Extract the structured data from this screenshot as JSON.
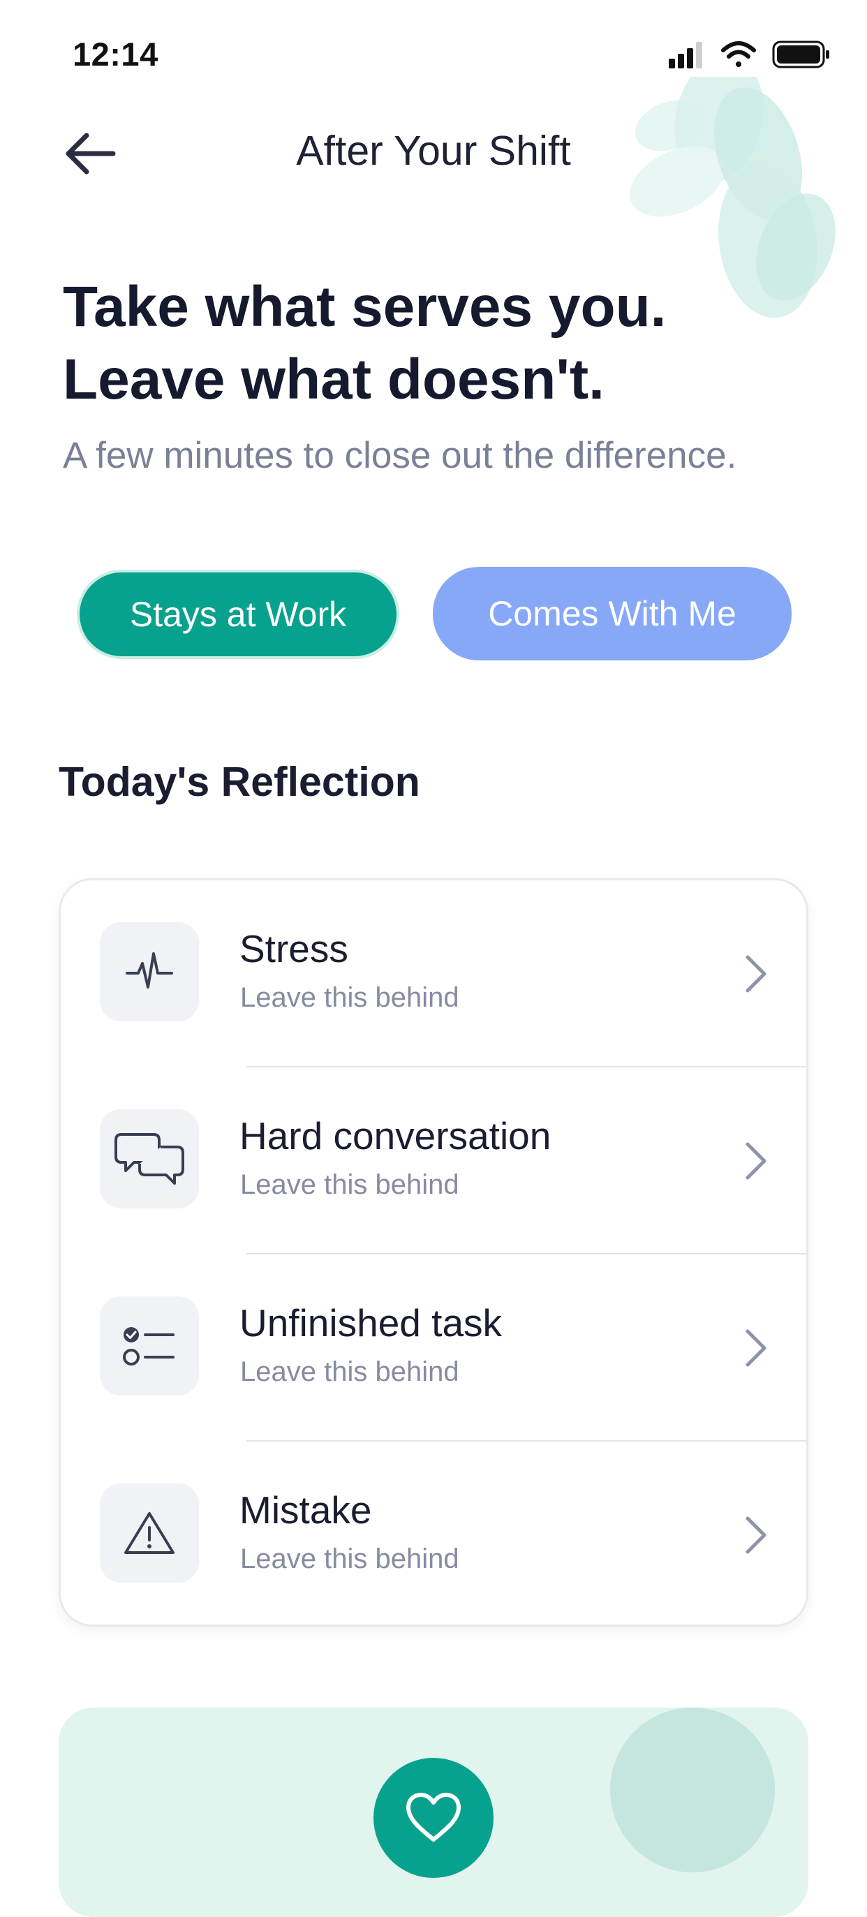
{
  "status_bar": {
    "time": "12:14",
    "icons": [
      "signal-icon",
      "wifi-icon",
      "battery-icon"
    ]
  },
  "nav": {
    "back_icon": "arrow-left-icon",
    "title": "After Your Shift"
  },
  "headline": {
    "line1": "Take what serves you.",
    "line2": "Leave what doesn't."
  },
  "subheadline": "A few minutes to close out the difference.",
  "toggle": {
    "stays_label": "Stays at Work",
    "comes_label": "Comes With Me"
  },
  "reflection": {
    "title": "Today's Reflection",
    "items": [
      {
        "label": "Stress",
        "sub": "Leave this behind",
        "icon": "pulse-icon"
      },
      {
        "label": "Hard conversation",
        "sub": "Leave this behind",
        "icon": "chat-bubbles-icon"
      },
      {
        "label": "Unfinished task",
        "sub": "Leave this behind",
        "icon": "checklist-icon"
      },
      {
        "label": "Mistake",
        "sub": "Leave this behind",
        "icon": "warning-icon"
      }
    ]
  },
  "bottom_card": {
    "icon": "heart-icon"
  },
  "colors": {
    "accent_teal": "#07a28e",
    "accent_blue": "#86a8f6",
    "mint_background": "#e2f4ee",
    "text_dark": "#181b2e",
    "text_muted": "#868ba1"
  }
}
